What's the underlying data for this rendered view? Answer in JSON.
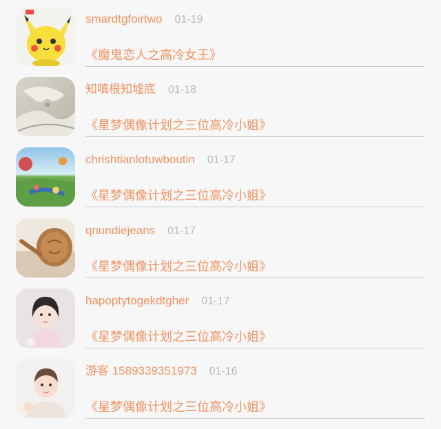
{
  "comments": [
    {
      "avatar": "pikachu-avatar-icon",
      "name": "smardtgfoirtwo",
      "date": "01-19",
      "title": "《魔鬼恋人之高冷女王》"
    },
    {
      "avatar": "cloth-avatar-icon",
      "name": "知嗔根知墟底",
      "date": "01-18",
      "title": "《星梦偶像计划之三位高冷小姐》"
    },
    {
      "avatar": "landscape-avatar-icon",
      "name": "chrishtianlotuwboutin",
      "date": "01-17",
      "title": "《星梦偶像计划之三位高冷小姐》"
    },
    {
      "avatar": "wood-avatar-icon",
      "name": "qnundiejeans",
      "date": "01-17",
      "title": "《星梦偶像计划之三位高冷小姐》"
    },
    {
      "avatar": "girl-avatar-icon",
      "name": "hapoptytogekdtgher",
      "date": "01-17",
      "title": "《星梦偶像计划之三位高冷小姐》"
    },
    {
      "avatar": "baby-avatar-icon",
      "name": "游客 1589339351973",
      "date": "01-16",
      "title": "《星梦偶像计划之三位高冷小姐》"
    }
  ],
  "colors": {
    "accent": "#ef9463",
    "date": "#b9b9b9",
    "divider": "#c8c8c8",
    "background": "#f7f7f7"
  }
}
